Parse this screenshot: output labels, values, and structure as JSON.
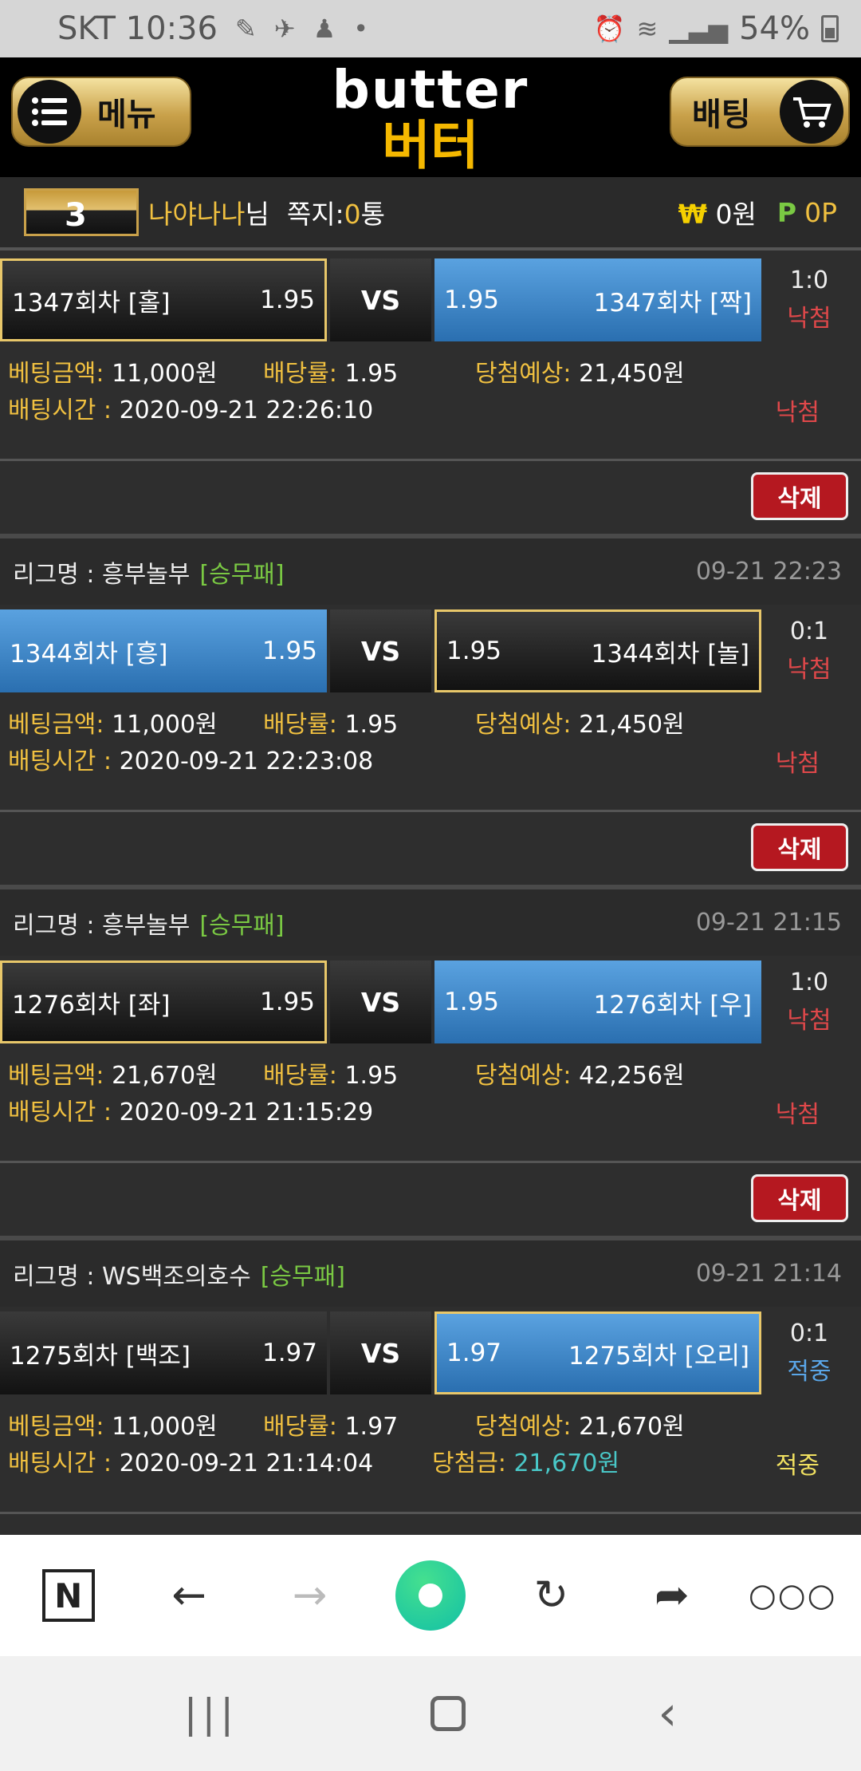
{
  "status": {
    "carrier_time": "SKT 10:36",
    "battery": "54%"
  },
  "header": {
    "menu_label": "메뉴",
    "logo_en": "butter",
    "logo_ko": "버터",
    "bet_label": "배팅"
  },
  "user": {
    "name": "나야나나",
    "suffix": "님",
    "msg_label": "쪽지:",
    "msg_count": "0",
    "msg_unit": "통",
    "won_symbol": "₩",
    "money": "0원",
    "point_symbol": "P",
    "points": "0P"
  },
  "labels": {
    "amount": "베팅금액:",
    "odds": "배당률:",
    "expected": "당첨예상:",
    "time": "배팅시간 :",
    "win_amount": "당첨금:",
    "league": "리그명 :",
    "vs": "VS",
    "delete": "삭제"
  },
  "bets": [
    {
      "league": "",
      "tag": "",
      "date": "",
      "home": {
        "name": "1347회차 [홀]",
        "odds": "1.95"
      },
      "away": {
        "name": "1347회차 [짝]",
        "odds": "1.95"
      },
      "score": "1:0",
      "result": "낙첨",
      "amount": "11,000원",
      "odds": "1.95",
      "expected": "21,450원",
      "time": "2020-09-21 22:26:10",
      "status": "낙첨",
      "win_amount": ""
    },
    {
      "league": "흥부놀부",
      "tag": "[승무패]",
      "date": "09-21 22:23",
      "home": {
        "name": "1344회차 [흥]",
        "odds": "1.95"
      },
      "away": {
        "name": "1344회차 [놀]",
        "odds": "1.95"
      },
      "score": "0:1",
      "result": "낙첨",
      "amount": "11,000원",
      "odds": "1.95",
      "expected": "21,450원",
      "time": "2020-09-21 22:23:08",
      "status": "낙첨",
      "win_amount": ""
    },
    {
      "league": "흥부놀부",
      "tag": "[승무패]",
      "date": "09-21 21:15",
      "home": {
        "name": "1276회차 [좌]",
        "odds": "1.95"
      },
      "away": {
        "name": "1276회차 [우]",
        "odds": "1.95"
      },
      "score": "1:0",
      "result": "낙첨",
      "amount": "21,670원",
      "odds": "1.95",
      "expected": "42,256원",
      "time": "2020-09-21 21:15:29",
      "status": "낙첨",
      "win_amount": ""
    },
    {
      "league": "WS백조의호수",
      "tag": "[승무패]",
      "date": "09-21 21:14",
      "home": {
        "name": "1275회차 [백조]",
        "odds": "1.97"
      },
      "away": {
        "name": "1275회차 [오리]",
        "odds": "1.97"
      },
      "score": "0:1",
      "result": "적중",
      "amount": "11,000원",
      "odds": "1.97",
      "expected": "21,670원",
      "time": "2020-09-21 21:14:04",
      "status": "적중",
      "win_amount": "21,670원"
    }
  ],
  "colors": {
    "gold": "#f0c040",
    "lose": "#e0484a",
    "win_blue": "#5aa6e8",
    "delete_red": "#b51820"
  }
}
